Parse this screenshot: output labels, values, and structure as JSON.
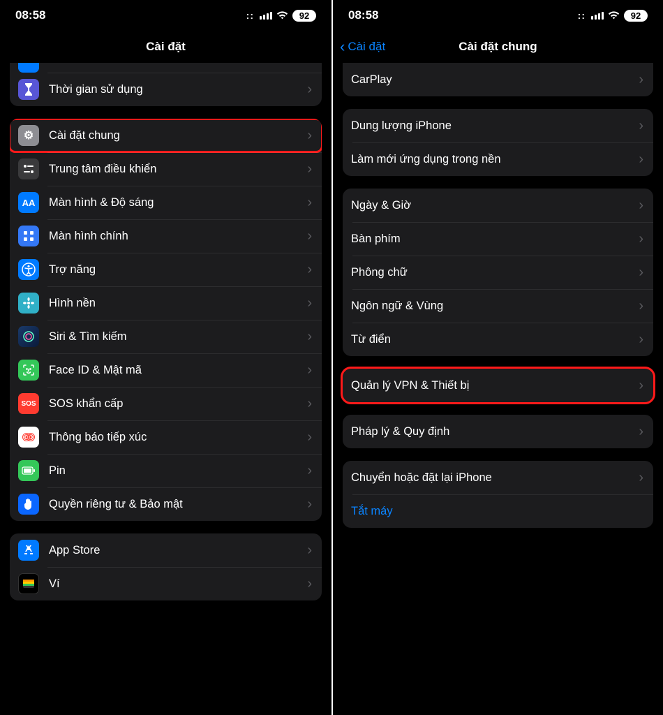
{
  "status": {
    "time": "08:58",
    "battery": "92"
  },
  "left": {
    "title": "Cài đặt",
    "partial_icon": "settings-blue-icon",
    "group1": [
      {
        "name": "screentime",
        "label": "Thời gian sử dụng",
        "icon": "hourglass-icon",
        "bg": "bg-purple",
        "glyph": "⌛"
      }
    ],
    "group2": [
      {
        "name": "general",
        "label": "Cài đặt chung",
        "icon": "gear-icon",
        "bg": "bg-gray",
        "glyph": "⚙",
        "hl": true
      },
      {
        "name": "control-center",
        "label": "Trung tâm điều khiển",
        "icon": "toggles-icon",
        "bg": "bg-darkgray",
        "glyph": "�调"
      },
      {
        "name": "display",
        "label": "Màn hình & Độ sáng",
        "icon": "text-size-icon",
        "bg": "bg-blue",
        "glyph": "AA"
      },
      {
        "name": "home-screen",
        "label": "Màn hình chính",
        "icon": "grid-icon",
        "bg": "bg-homescreen",
        "glyph": "⋮⋮⋮"
      },
      {
        "name": "accessibility",
        "label": "Trợ năng",
        "icon": "accessibility-icon",
        "bg": "bg-blue",
        "glyph": "➀"
      },
      {
        "name": "wallpaper",
        "label": "Hình nền",
        "icon": "flower-icon",
        "bg": "bg-teal",
        "glyph": "❀"
      },
      {
        "name": "siri",
        "label": "Siri & Tìm kiếm",
        "icon": "siri-icon",
        "bg": "bg-siri",
        "glyph": "◎"
      },
      {
        "name": "faceid",
        "label": "Face ID & Mật mã",
        "icon": "faceid-icon",
        "bg": "bg-green",
        "glyph": "☺"
      },
      {
        "name": "sos",
        "label": "SOS khẩn cấp",
        "icon": "sos-icon",
        "bg": "bg-red",
        "glyph": "SOS"
      },
      {
        "name": "exposure",
        "label": "Thông báo tiếp xúc",
        "icon": "exposure-icon",
        "bg": "bg-white",
        "glyph": "⁜"
      },
      {
        "name": "battery",
        "label": "Pin",
        "icon": "battery-icon",
        "bg": "bg-green",
        "glyph": "▮"
      },
      {
        "name": "privacy",
        "label": "Quyền riêng tư & Bảo mật",
        "icon": "hand-icon",
        "bg": "bg-hand",
        "glyph": "✋"
      }
    ],
    "group3": [
      {
        "name": "app-store",
        "label": "App Store",
        "icon": "appstore-icon",
        "bg": "bg-blue",
        "glyph": "A"
      },
      {
        "name": "wallet",
        "label": "Ví",
        "icon": "wallet-icon",
        "bg": "bg-black",
        "glyph": "▭"
      }
    ]
  },
  "right": {
    "back": "Cài đặt",
    "title": "Cài đặt chung",
    "g1": [
      {
        "name": "carplay",
        "label": "CarPlay"
      }
    ],
    "g2": [
      {
        "name": "iphone-storage",
        "label": "Dung lượng iPhone"
      },
      {
        "name": "background-refresh",
        "label": "Làm mới ứng dụng trong nền"
      }
    ],
    "g3": [
      {
        "name": "date-time",
        "label": "Ngày & Giờ"
      },
      {
        "name": "keyboard",
        "label": "Bàn phím"
      },
      {
        "name": "fonts",
        "label": "Phông chữ"
      },
      {
        "name": "language-region",
        "label": "Ngôn ngữ & Vùng"
      },
      {
        "name": "dictionary",
        "label": "Từ điển"
      }
    ],
    "g4": [
      {
        "name": "vpn-device",
        "label": "Quản lý VPN & Thiết bị",
        "hl": true
      }
    ],
    "g5": [
      {
        "name": "legal",
        "label": "Pháp lý & Quy định"
      }
    ],
    "g6": [
      {
        "name": "transfer-reset",
        "label": "Chuyển hoặc đặt lại iPhone"
      },
      {
        "name": "shutdown",
        "label": "Tắt máy",
        "link": true,
        "nochev": true
      }
    ]
  }
}
